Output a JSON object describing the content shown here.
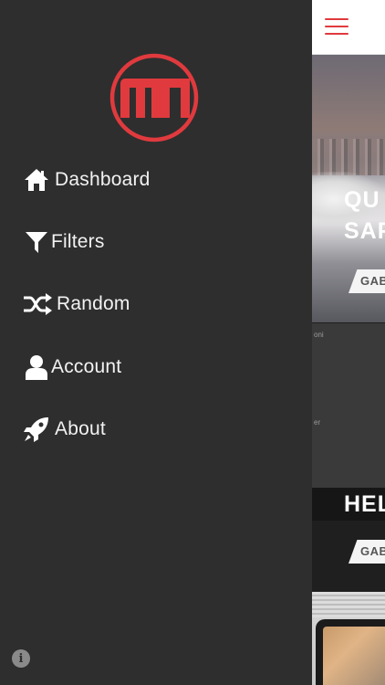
{
  "drawer": {
    "logo_text": "m1",
    "items": [
      {
        "label": "Dashboard",
        "icon": "home-icon"
      },
      {
        "label": "Filters",
        "icon": "filter-icon"
      },
      {
        "label": "Random",
        "icon": "shuffle-icon"
      },
      {
        "label": "Account",
        "icon": "user-icon"
      },
      {
        "label": "About",
        "icon": "rocket-icon"
      }
    ],
    "info_label": "i"
  },
  "main": {
    "cards": [
      {
        "title_line1": "QU",
        "title_line2": "SAF",
        "badge": "GAB"
      },
      {
        "title": "HEL",
        "badge": "GAB",
        "fragments": [
          "oni",
          "er"
        ]
      }
    ]
  },
  "colors": {
    "accent": "#e03a3e",
    "drawer_bg": "#2e2e2e",
    "text": "#f2f2f2"
  }
}
